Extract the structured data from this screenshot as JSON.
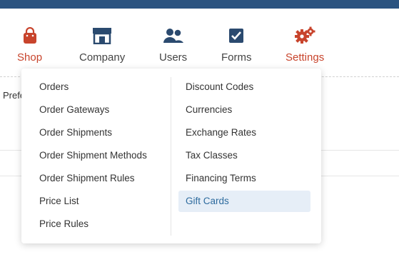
{
  "nav": {
    "items": [
      {
        "label": "Shop",
        "icon": "shopping-bag-icon"
      },
      {
        "label": "Company",
        "icon": "storefront-icon"
      },
      {
        "label": "Users",
        "icon": "users-icon"
      },
      {
        "label": "Forms",
        "icon": "checkbox-icon"
      },
      {
        "label": "Settings",
        "icon": "gears-icon"
      }
    ],
    "active_color": "#c8442c",
    "top_bar_color": "#2b5380"
  },
  "page": {
    "partial_text": "Prefe"
  },
  "dropdown": {
    "left_column": [
      "Orders",
      "Order Gateways",
      "Order Shipments",
      "Order Shipment Methods",
      "Order Shipment Rules",
      "Price List",
      "Price Rules"
    ],
    "right_column": [
      "Discount Codes",
      "Currencies",
      "Exchange Rates",
      "Tax Classes",
      "Financing Terms",
      "Gift Cards"
    ],
    "highlighted": "Gift Cards"
  }
}
